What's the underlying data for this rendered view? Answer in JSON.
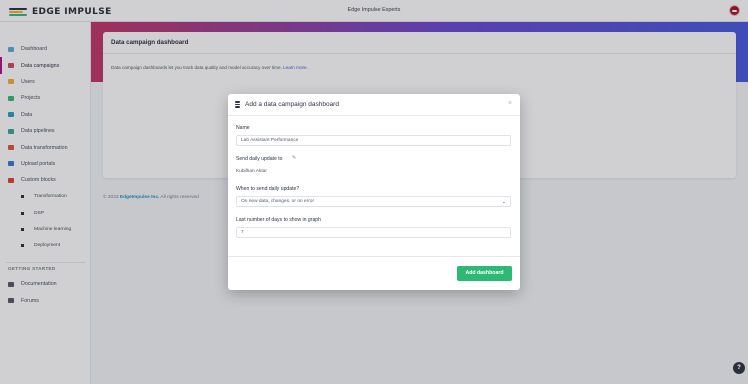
{
  "app": {
    "logo_text": "EDGE IMPULSE",
    "top_title": "Edge Impulse Experts"
  },
  "colors": {
    "accent": "#b0148a",
    "primary_button": "#2eb875",
    "link": "#4a5be0",
    "banner_start": "#c2386a",
    "banner_end": "#4a5be0"
  },
  "sidebar": {
    "items": [
      {
        "label": "Dashboard",
        "icon": "dashboard-icon",
        "color": "#5ab1d6"
      },
      {
        "label": "Data campaigns",
        "icon": "chart-line-icon",
        "color": "#d24a6a",
        "active": true
      },
      {
        "label": "Users",
        "icon": "users-icon",
        "color": "#f2b33a"
      },
      {
        "label": "Projects",
        "icon": "projects-icon",
        "color": "#3cb87a"
      },
      {
        "label": "Data",
        "icon": "database-icon",
        "color": "#2d9fc4"
      },
      {
        "label": "Data pipelines",
        "icon": "pipeline-icon",
        "color": "#3aa8a0"
      },
      {
        "label": "Data transformation",
        "icon": "transform-icon",
        "color": "#e05a3a"
      },
      {
        "label": "Upload portals",
        "icon": "cloud-upload-icon",
        "color": "#3a7ad8"
      },
      {
        "label": "Custom blocks",
        "icon": "cube-icon",
        "color": "#e0453a"
      },
      {
        "label": "Transformation",
        "icon": "bullet-icon",
        "sub": true
      },
      {
        "label": "DSP",
        "icon": "bullet-icon",
        "sub": true
      },
      {
        "label": "Machine learning",
        "icon": "bullet-icon",
        "sub": true
      },
      {
        "label": "Deployment",
        "icon": "bullet-icon",
        "sub": true
      }
    ],
    "section_label": "GETTING STARTED",
    "items2": [
      {
        "label": "Documentation",
        "icon": "book-icon",
        "color": "#555a6b"
      },
      {
        "label": "Forums",
        "icon": "chat-icon",
        "color": "#555a6b"
      }
    ]
  },
  "main": {
    "card_title": "Data campaign dashboard",
    "card_desc": "Data campaign dashboards let you track data quality and model accuracy over time.",
    "card_link": "Learn more.",
    "footer_year": "© 2023",
    "footer_company": "EdgeImpulse Inc.",
    "footer_rights": "All rights reserved"
  },
  "modal": {
    "title": "Add a data campaign dashboard",
    "close": "×",
    "name_label": "Name",
    "name_value": "Lab Assistant Performance",
    "send_label": "Send daily update to",
    "send_value": "Kubilhan Aktar",
    "when_label": "When to send daily update?",
    "when_value": "On new data, changes, or on error",
    "days_label": "Last number of days to show in graph",
    "days_value": "7",
    "submit_label": "Add dashboard"
  },
  "help": {
    "label": "?"
  }
}
